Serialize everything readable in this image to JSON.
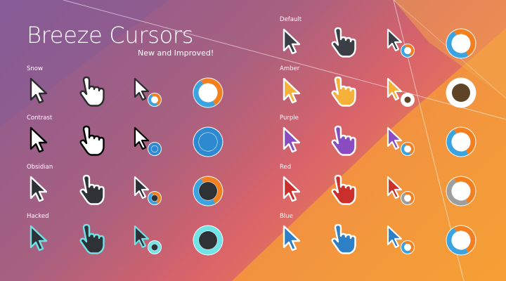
{
  "header": {
    "title": "Breeze Cursors",
    "subtitle": "New and Improved!"
  },
  "themes": [
    {
      "label": "Snow",
      "fill": "#ffffff",
      "stroke": "#2b2b2b",
      "accent": "#f47f1f",
      "accent2": "#3ba4e0",
      "busy_center": "#ffffff"
    },
    {
      "label": "Contrast",
      "fill": "#ffffff",
      "stroke": "#000000",
      "accent": "#2e8ad0",
      "accent2": "#2e8ad0",
      "busy_center": "#2e8ad0"
    },
    {
      "label": "Obsidian",
      "fill": "#2e3136",
      "stroke": "#ffffff",
      "accent": "#f47f1f",
      "accent2": "#3ba4e0",
      "busy_center": "#2e3136"
    },
    {
      "label": "Hacked",
      "fill": "#2e3136",
      "stroke": "#6fe3e6",
      "accent": "#6fe3e6",
      "accent2": "#6fe3e6",
      "busy_center": "#2e3136"
    },
    {
      "label": "Default",
      "fill": "#3b3f45",
      "stroke": "#ffffff",
      "accent": "#f47f1f",
      "accent2": "#3ba4e0",
      "busy_center": "#ffffff"
    },
    {
      "label": "Amber",
      "fill": "#f6b13a",
      "stroke": "#ffffff",
      "accent": "#ffffff",
      "accent2": "#ffffff",
      "busy_center": "#5e4326"
    },
    {
      "label": "Purple",
      "fill": "#8a4cc1",
      "stroke": "#ffffff",
      "accent": "#f47f1f",
      "accent2": "#3ba4e0",
      "busy_center": "#ffffff"
    },
    {
      "label": "Red",
      "fill": "#c9302c",
      "stroke": "#ffffff",
      "accent": "#f47f1f",
      "accent2": "#9e9e9e",
      "busy_center": "#ffffff"
    },
    {
      "label": "Blue",
      "fill": "#2d7fc6",
      "stroke": "#ffffff",
      "accent": "#f47f1f",
      "accent2": "#3ba4e0",
      "busy_center": "#ffffff"
    }
  ],
  "cursor_kinds": [
    "arrow",
    "hand",
    "progress",
    "busy"
  ],
  "colors": {
    "bg_purple": "#7a5a96",
    "bg_pink": "#c96a7a",
    "bg_orange": "#f3a13a"
  }
}
